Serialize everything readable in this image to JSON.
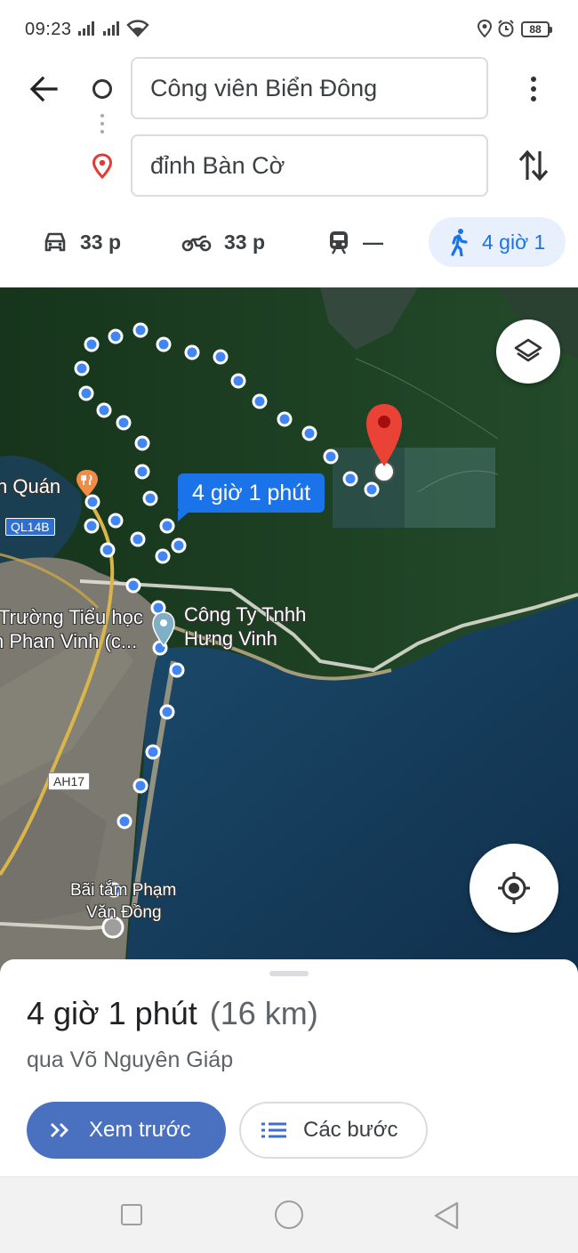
{
  "status_bar": {
    "time": "09:23",
    "battery": "88",
    "icons": [
      "signal-icon",
      "signal-icon",
      "wifi-icon",
      "location-icon",
      "alarm-icon",
      "battery-icon"
    ]
  },
  "directions": {
    "origin": "Công viên Biển Đông",
    "destination": "đỉnh Bàn Cờ"
  },
  "modes": [
    {
      "icon": "car-icon",
      "label": "33 p"
    },
    {
      "icon": "motorbike-icon",
      "label": "33 p"
    },
    {
      "icon": "transit-icon",
      "label": "—"
    },
    {
      "icon": "walk-icon",
      "label": "4 giờ 1",
      "selected": true
    }
  ],
  "map": {
    "route_label": "4 giờ 1 phút",
    "places": {
      "restaurant": "n Quán",
      "school_line1": "Trường Tiểu học",
      "school_line2": "n Phan Vinh (c...",
      "company_line1": "Công Ty Tnhh",
      "company_line2": "Hưng Vinh",
      "beach_line1": "Bãi tắm Phạm",
      "beach_line2": "Văn Đồng"
    },
    "roads": {
      "ql14b": "QL14B",
      "ah17": "AH17"
    },
    "colors": {
      "route": "#4285f4",
      "pin": "#ea4335"
    }
  },
  "summary": {
    "duration": "4 giờ 1 phút",
    "distance": "(16 km)",
    "via": "qua Võ Nguyên Giáp",
    "preview_label": "Xem trước",
    "steps_label": "Các bước"
  }
}
